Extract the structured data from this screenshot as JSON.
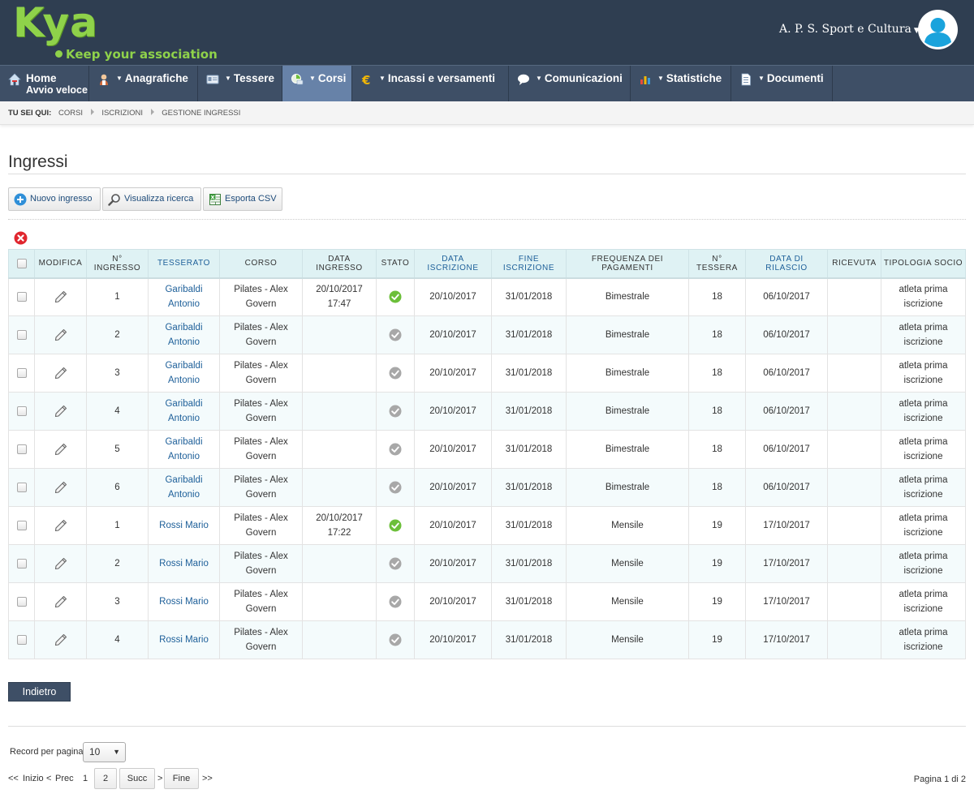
{
  "header": {
    "logo_text": "Kya",
    "logo_tagline": "Keep your association",
    "org_name": "A. P. S. Sport e Cultura",
    "brand_color": "#8fd24a",
    "header_bg": "#2f3e51"
  },
  "nav": {
    "items": [
      {
        "label": "Home",
        "sub": "Avvio veloce",
        "icon": "home-icon"
      },
      {
        "label": "Anagrafiche",
        "icon": "person-icon",
        "dropdown": true
      },
      {
        "label": "Tessere",
        "icon": "card-icon",
        "dropdown": true
      },
      {
        "label": "Corsi",
        "icon": "courses-icon",
        "dropdown": true,
        "active": true
      },
      {
        "label": "Incassi e versamenti",
        "icon": "euro-icon",
        "dropdown": true
      },
      {
        "label": "Comunicazioni",
        "icon": "speech-bubble-icon",
        "dropdown": true
      },
      {
        "label": "Statistiche",
        "icon": "bar-chart-icon",
        "dropdown": true
      },
      {
        "label": "Documenti",
        "icon": "document-icon",
        "dropdown": true
      }
    ],
    "active_color": "#6782a8"
  },
  "breadcrumb": {
    "head": "TU SEI QUI:",
    "items": [
      "CORSI",
      "ISCRIZIONI",
      "GESTIONE INGRESSI"
    ]
  },
  "page": {
    "title": "Ingressi"
  },
  "toolbar": {
    "new_label": "Nuovo ingresso",
    "search_label": "Visualizza ricerca",
    "csv_label": "Esporta CSV"
  },
  "table": {
    "headers": {
      "modifica": "MODIFICA",
      "n_ingresso": "N° INGRESSO",
      "tesserato": "TESSERATO",
      "corso": "CORSO",
      "data_ingresso": "DATA INGRESSO",
      "stato": "STATO",
      "data_iscrizione": "DATA ISCRIZIONE",
      "fine_iscrizione": "FINE ISCRIZIONE",
      "frequenza": "FREQUENZA DEI PAGAMENTI",
      "n_tessera": "N° TESSERA",
      "data_rilascio": "DATA DI RILASCIO",
      "ricevuta": "RICEVUTA",
      "tipologia": "TIPOLOGIA SOCIO"
    },
    "rows": [
      {
        "n_ingresso": "1",
        "tesserato": "Garibaldi Antonio",
        "corso": "Pilates - Alex Govern",
        "data_ingresso": "20/10/2017 17:47",
        "stato": "done",
        "data_iscrizione": "20/10/2017",
        "fine_iscrizione": "31/01/2018",
        "frequenza": "Bimestrale",
        "n_tessera": "18",
        "data_rilascio": "06/10/2017",
        "ricevuta": "",
        "tipologia": "atleta prima iscrizione"
      },
      {
        "n_ingresso": "2",
        "tesserato": "Garibaldi Antonio",
        "corso": "Pilates - Alex Govern",
        "data_ingresso": "",
        "stato": "pending",
        "data_iscrizione": "20/10/2017",
        "fine_iscrizione": "31/01/2018",
        "frequenza": "Bimestrale",
        "n_tessera": "18",
        "data_rilascio": "06/10/2017",
        "ricevuta": "",
        "tipologia": "atleta prima iscrizione"
      },
      {
        "n_ingresso": "3",
        "tesserato": "Garibaldi Antonio",
        "corso": "Pilates - Alex Govern",
        "data_ingresso": "",
        "stato": "pending",
        "data_iscrizione": "20/10/2017",
        "fine_iscrizione": "31/01/2018",
        "frequenza": "Bimestrale",
        "n_tessera": "18",
        "data_rilascio": "06/10/2017",
        "ricevuta": "",
        "tipologia": "atleta prima iscrizione"
      },
      {
        "n_ingresso": "4",
        "tesserato": "Garibaldi Antonio",
        "corso": "Pilates - Alex Govern",
        "data_ingresso": "",
        "stato": "pending",
        "data_iscrizione": "20/10/2017",
        "fine_iscrizione": "31/01/2018",
        "frequenza": "Bimestrale",
        "n_tessera": "18",
        "data_rilascio": "06/10/2017",
        "ricevuta": "",
        "tipologia": "atleta prima iscrizione"
      },
      {
        "n_ingresso": "5",
        "tesserato": "Garibaldi Antonio",
        "corso": "Pilates - Alex Govern",
        "data_ingresso": "",
        "stato": "pending",
        "data_iscrizione": "20/10/2017",
        "fine_iscrizione": "31/01/2018",
        "frequenza": "Bimestrale",
        "n_tessera": "18",
        "data_rilascio": "06/10/2017",
        "ricevuta": "",
        "tipologia": "atleta prima iscrizione"
      },
      {
        "n_ingresso": "6",
        "tesserato": "Garibaldi Antonio",
        "corso": "Pilates - Alex Govern",
        "data_ingresso": "",
        "stato": "pending",
        "data_iscrizione": "20/10/2017",
        "fine_iscrizione": "31/01/2018",
        "frequenza": "Bimestrale",
        "n_tessera": "18",
        "data_rilascio": "06/10/2017",
        "ricevuta": "",
        "tipologia": "atleta prima iscrizione"
      },
      {
        "n_ingresso": "1",
        "tesserato": "Rossi Mario",
        "corso": "Pilates - Alex Govern",
        "data_ingresso": "20/10/2017 17:22",
        "stato": "done",
        "data_iscrizione": "20/10/2017",
        "fine_iscrizione": "31/01/2018",
        "frequenza": "Mensile",
        "n_tessera": "19",
        "data_rilascio": "17/10/2017",
        "ricevuta": "",
        "tipologia": "atleta prima iscrizione"
      },
      {
        "n_ingresso": "2",
        "tesserato": "Rossi Mario",
        "corso": "Pilates - Alex Govern",
        "data_ingresso": "",
        "stato": "pending",
        "data_iscrizione": "20/10/2017",
        "fine_iscrizione": "31/01/2018",
        "frequenza": "Mensile",
        "n_tessera": "19",
        "data_rilascio": "17/10/2017",
        "ricevuta": "",
        "tipologia": "atleta prima iscrizione"
      },
      {
        "n_ingresso": "3",
        "tesserato": "Rossi Mario",
        "corso": "Pilates - Alex Govern",
        "data_ingresso": "",
        "stato": "pending",
        "data_iscrizione": "20/10/2017",
        "fine_iscrizione": "31/01/2018",
        "frequenza": "Mensile",
        "n_tessera": "19",
        "data_rilascio": "17/10/2017",
        "ricevuta": "",
        "tipologia": "atleta prima iscrizione"
      },
      {
        "n_ingresso": "4",
        "tesserato": "Rossi Mario",
        "corso": "Pilates - Alex Govern",
        "data_ingresso": "",
        "stato": "pending",
        "data_iscrizione": "20/10/2017",
        "fine_iscrizione": "31/01/2018",
        "frequenza": "Mensile",
        "n_tessera": "19",
        "data_rilascio": "17/10/2017",
        "ricevuta": "",
        "tipologia": "atleta prima iscrizione"
      }
    ],
    "status_colors": {
      "done": "#6cbf3a",
      "pending": "#a8a8a8"
    }
  },
  "footer": {
    "back_label": "Indietro",
    "rpp_label": "Record per pagina",
    "rpp_value": "10",
    "first_marker": "<<",
    "first_label": "Inizio",
    "prev_marker": "<",
    "prev_label": "Prec",
    "pages": [
      "1",
      "2"
    ],
    "next_label": "Succ",
    "next_marker": ">",
    "last_label": "Fine",
    "last_marker": ">>",
    "page_info": "Pagina 1 di 2"
  }
}
